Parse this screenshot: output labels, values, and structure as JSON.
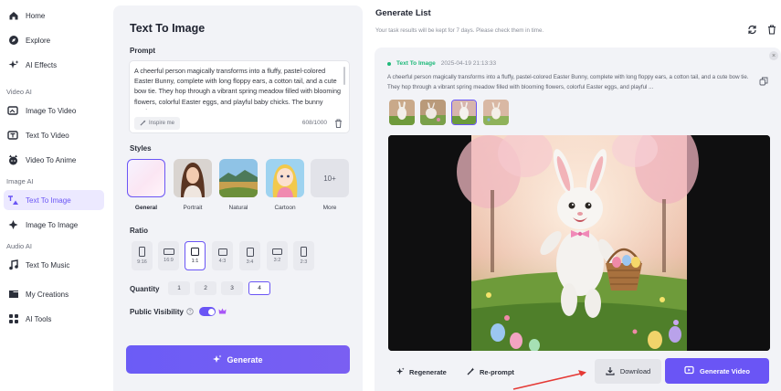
{
  "sidebar": {
    "items": [
      {
        "label": "Home",
        "icon": "home-icon"
      },
      {
        "label": "Explore",
        "icon": "compass-icon"
      },
      {
        "label": "AI Effects",
        "icon": "sparkle-icon"
      },
      {
        "label": "Image To Video",
        "icon": "image-video-icon"
      },
      {
        "label": "Text To Video",
        "icon": "text-video-icon"
      },
      {
        "label": "Video To Anime",
        "icon": "anime-icon"
      },
      {
        "label": "Text To Image",
        "icon": "text-image-icon"
      },
      {
        "label": "Image To Image",
        "icon": "image-image-icon"
      },
      {
        "label": "Text To Music",
        "icon": "music-icon"
      },
      {
        "label": "My Creations",
        "icon": "folder-icon"
      },
      {
        "label": "AI Tools",
        "icon": "grid-icon"
      }
    ],
    "sections": [
      "Video AI",
      "Image AI",
      "Audio AI"
    ],
    "active": "Text To Image"
  },
  "form": {
    "title": "Text To Image",
    "prompt_label": "Prompt",
    "prompt_text": "A cheerful person magically transforms into a fluffy, pastel-colored Easter Bunny, complete with long floppy ears, a cotton tail, and a cute bow tie. They hop through a vibrant spring meadow filled with blooming flowers, colorful Easter eggs, and playful baby chicks. The bunny carries a woven",
    "inspire_label": "Inspire me",
    "char_count": "608/1000",
    "styles_label": "Styles",
    "styles": [
      {
        "name": "General"
      },
      {
        "name": "Portrait"
      },
      {
        "name": "Natural"
      },
      {
        "name": "Cartoon"
      },
      {
        "name": "More",
        "badge": "10+"
      }
    ],
    "active_style": "General",
    "ratio_label": "Ratio",
    "ratios": [
      "9:16",
      "16:9",
      "1:1",
      "4:3",
      "3:4",
      "3:2",
      "2:3"
    ],
    "active_ratio": "1:1",
    "quantity_label": "Quantity",
    "quantities": [
      "1",
      "2",
      "3",
      "4"
    ],
    "active_quantity": "4",
    "visibility_label": "Public Visibility",
    "visibility_on": true,
    "generate_label": "Generate"
  },
  "results": {
    "title": "Generate List",
    "subtitle": "Your task results will be kept for 7 days. Please check them in time.",
    "tag": "Text To Image",
    "date": "2025-04-19 21:13:33",
    "prompt_preview": "A cheerful person magically transforms into a fluffy, pastel-colored Easter Bunny, complete with long floppy ears, a cotton tail, and a cute bow tie. They hop through a vibrant spring meadow filled with blooming flowers, colorful Easter eggs, and playful ...",
    "regenerate_label": "Regenerate",
    "reprompt_label": "Re-prompt",
    "download_label": "Download",
    "generate_video_label": "Generate Video"
  },
  "colors": {
    "accent": "#6a55f5",
    "success": "#1fb97a",
    "annotation": "#e53935"
  }
}
